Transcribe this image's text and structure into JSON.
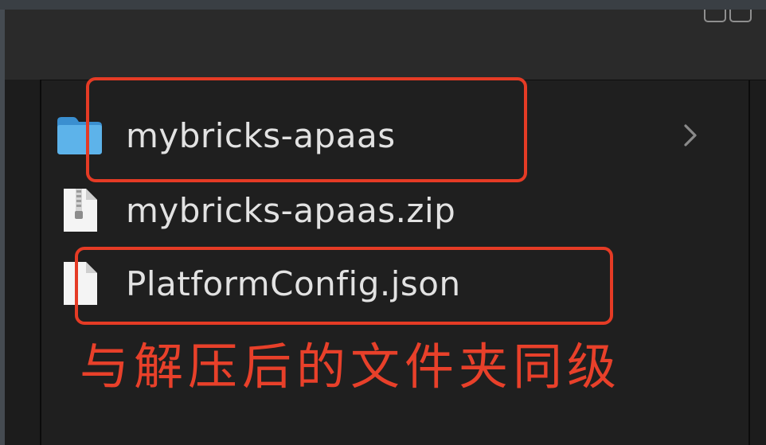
{
  "files": [
    {
      "name": "mybricks-apaas",
      "icon": "folder-icon",
      "has_children": true
    },
    {
      "name": "mybricks-apaas.zip",
      "icon": "zip-file-icon",
      "has_children": false
    },
    {
      "name": "PlatformConfig.json",
      "icon": "document-icon",
      "has_children": false
    }
  ],
  "annotation": {
    "text": "与解压后的文件夹同级",
    "color": "#e8402a"
  },
  "colors": {
    "highlight": "#e53b25",
    "folder": "#4aa3df",
    "background": "#1f1f1f"
  }
}
